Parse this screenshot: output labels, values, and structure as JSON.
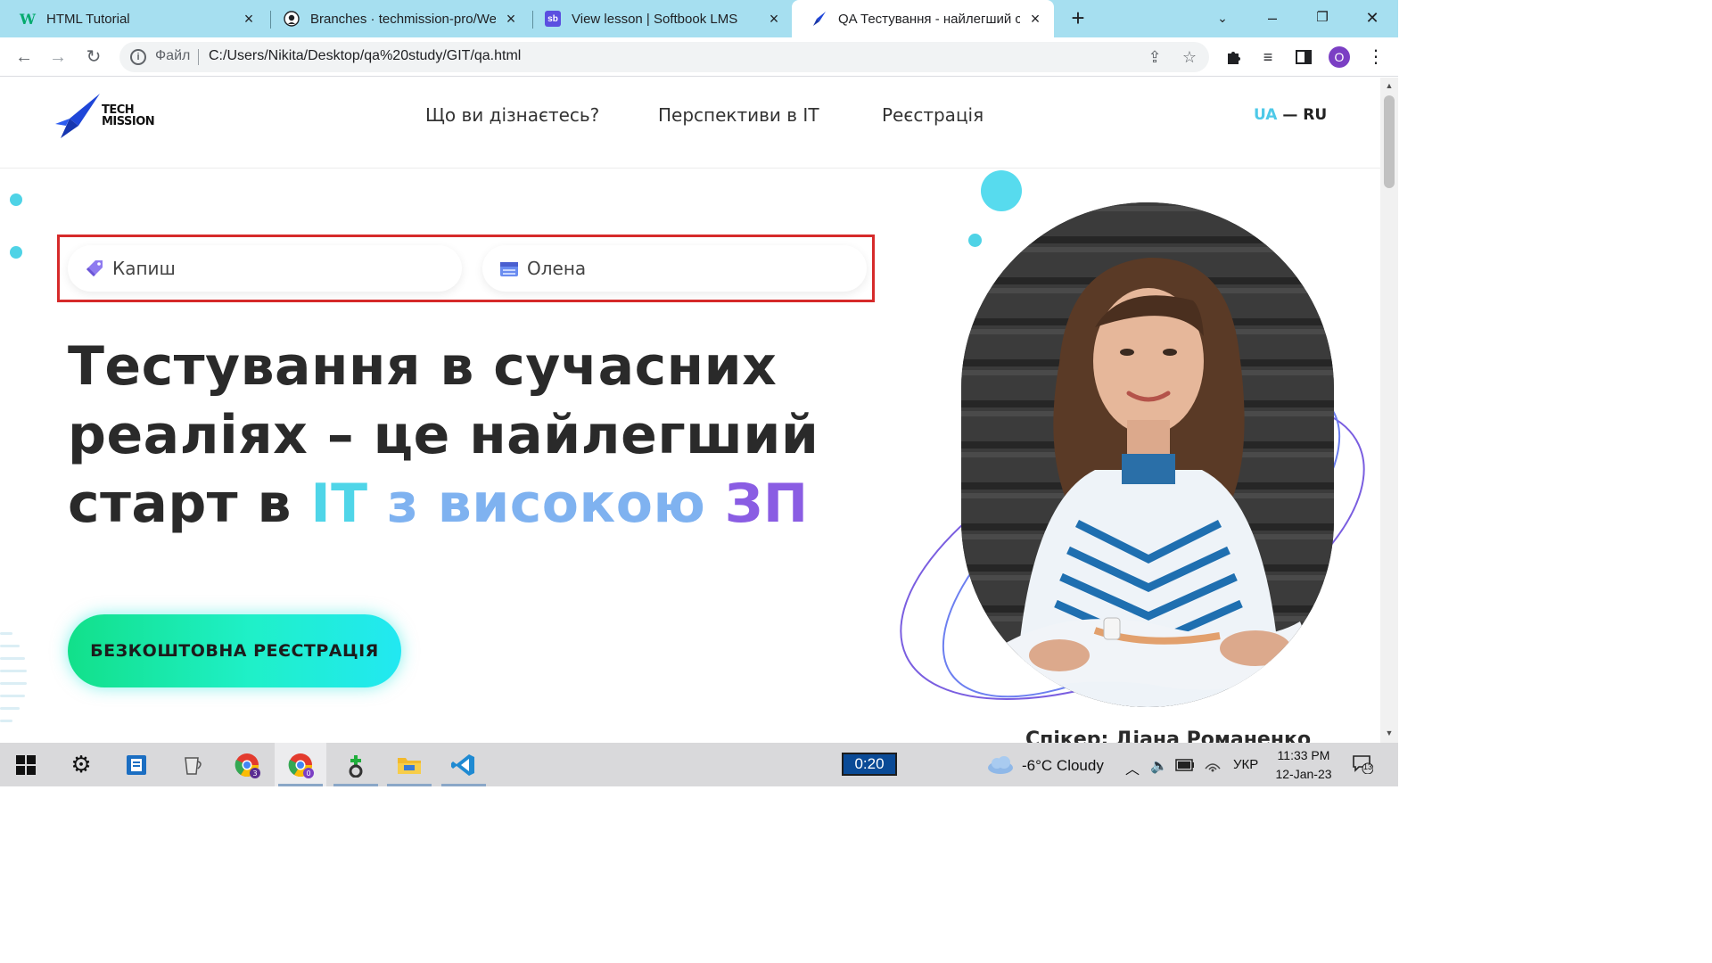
{
  "browser": {
    "tabs": [
      {
        "title": "HTML Tutorial",
        "favicon": "w3schools-icon",
        "active": false
      },
      {
        "title": "Branches · techmission-pro/WebI",
        "favicon": "github-icon",
        "active": false
      },
      {
        "title": "View lesson | Softbook LMS",
        "favicon": "softbook-icon",
        "active": false
      },
      {
        "title": "QA Тестування - найлегший ста",
        "favicon": "rocket-icon",
        "active": true
      }
    ],
    "favicon_labels": {
      "softbook": "sb"
    },
    "address": {
      "scheme_label": "Файл",
      "url": "C:/Users/Nikita/Desktop/qa%20study/GIT/qa.html"
    },
    "profile_initial": "O"
  },
  "site": {
    "logo_line1": "TECH",
    "logo_line2": "MISSION",
    "nav": [
      "Що ви дізнаєтесь?",
      "Перспективи в IT",
      "Реєстрація"
    ],
    "lang_ua": "UA",
    "lang_sep": "—",
    "lang_ru": "RU",
    "pills": [
      {
        "text": "Капиш",
        "icon": "price-tag-icon"
      },
      {
        "text": "Олена",
        "icon": "calendar-icon"
      }
    ],
    "hero": {
      "line1": "Тестування в сучасних",
      "line2": "реаліях – це найлегший",
      "line3_start": "старт в ",
      "hl_it": "IT",
      "hl_mid": " з високою ",
      "hl_zp": "ЗП"
    },
    "cta_label": "БЕЗКОШТОВНА РЕЄСТРАЦІЯ",
    "speaker_caption": "Спікер: Діана Романенко"
  },
  "taskbar": {
    "timer": "0:20",
    "weather": "-6°C  Cloudy",
    "language": "УКР",
    "time": "11:33 PM",
    "date": "12-Jan-23",
    "notifications": "13",
    "chrome_badges": [
      "3",
      "0"
    ]
  },
  "colors": {
    "tabstrip": "#a6dff0",
    "accent_cyan": "#4fd5e8",
    "accent_purple": "#8a5de3",
    "highlight_red": "#d62a2a"
  }
}
